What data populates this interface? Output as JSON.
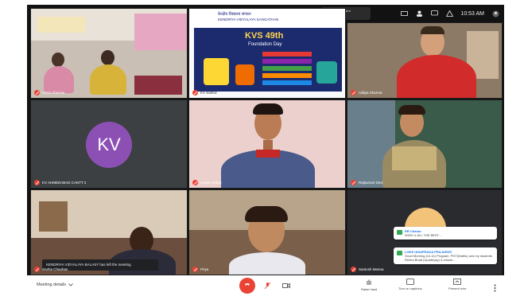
{
  "status_bar": {
    "notification_lines": [
      "Uttrakhand gurukul",
      "anil CTS (ind.)"
    ],
    "time": "10:53 AM",
    "icons": [
      "screen-share-icon",
      "people-icon",
      "chat-bubble-icon",
      "activity-icon",
      "user-icon"
    ]
  },
  "tiles": [
    {
      "name": "Vinita Sharma",
      "type": "video"
    },
    {
      "name": "KV Sathrd",
      "type": "poster"
    },
    {
      "name": "Aditya Sharma",
      "type": "video"
    },
    {
      "name": "KV AHMEDABAD CANTT 2",
      "type": "avatar",
      "avatar_text": "KV",
      "avatar_color": "#8c50b5"
    },
    {
      "name": "Ayush Anand",
      "type": "video"
    },
    {
      "name": "Rajkumari Devi",
      "type": "video"
    },
    {
      "name": "Sneha Chauhan",
      "type": "video"
    },
    {
      "name": "Priya",
      "type": "video"
    },
    {
      "name": "Santosh Meena",
      "type": "video"
    }
  ],
  "poster": {
    "header_line1": "केन्द्रीय विद्यालय संगठन",
    "header_line2": "KENDRIYA VIDYALAYA SANGATHAN",
    "title": "KVS 49th",
    "subtitle": "Foundation Day"
  },
  "toast": {
    "text": "KENDRIYA VIDYALAYA BALASY has left the meeting"
  },
  "chat": [
    {
      "sender": "RR Chanur",
      "text": "WISH U ALL THE BEST..."
    },
    {
      "sender": "LOKE UDAIPRAKA PRAJAPATI",
      "text": "Good Morning (14-11) Program. PGT(Maths) and my students Rekha Bhatt (Upadhyay) 3-minute..."
    }
  ],
  "bottom_bar": {
    "meeting_details": "Meeting details",
    "raise_hand": "Raise hand",
    "captions": "Turn on captions",
    "present": "Present now"
  },
  "colors": {
    "end_call": "#ea4335",
    "mute": "#ea4335",
    "avatar": "#8c50b5"
  }
}
